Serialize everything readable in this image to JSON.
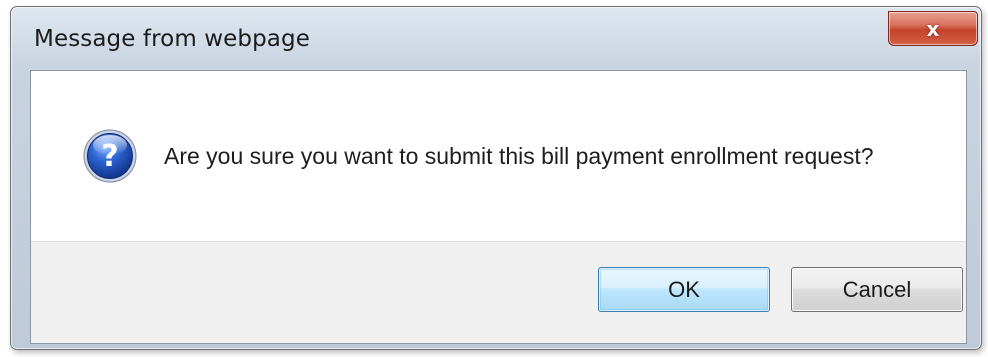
{
  "dialog": {
    "title": "Message from webpage",
    "close_icon_glyph": "x",
    "message": "Are you sure you want to submit this bill payment enrollment request?",
    "icon": "question-icon",
    "buttons": {
      "ok_label": "OK",
      "cancel_label": "Cancel"
    }
  },
  "colors": {
    "close_button": "#c4432a",
    "question_icon": "#1f4fb3",
    "ok_border": "#3c7fb1"
  }
}
